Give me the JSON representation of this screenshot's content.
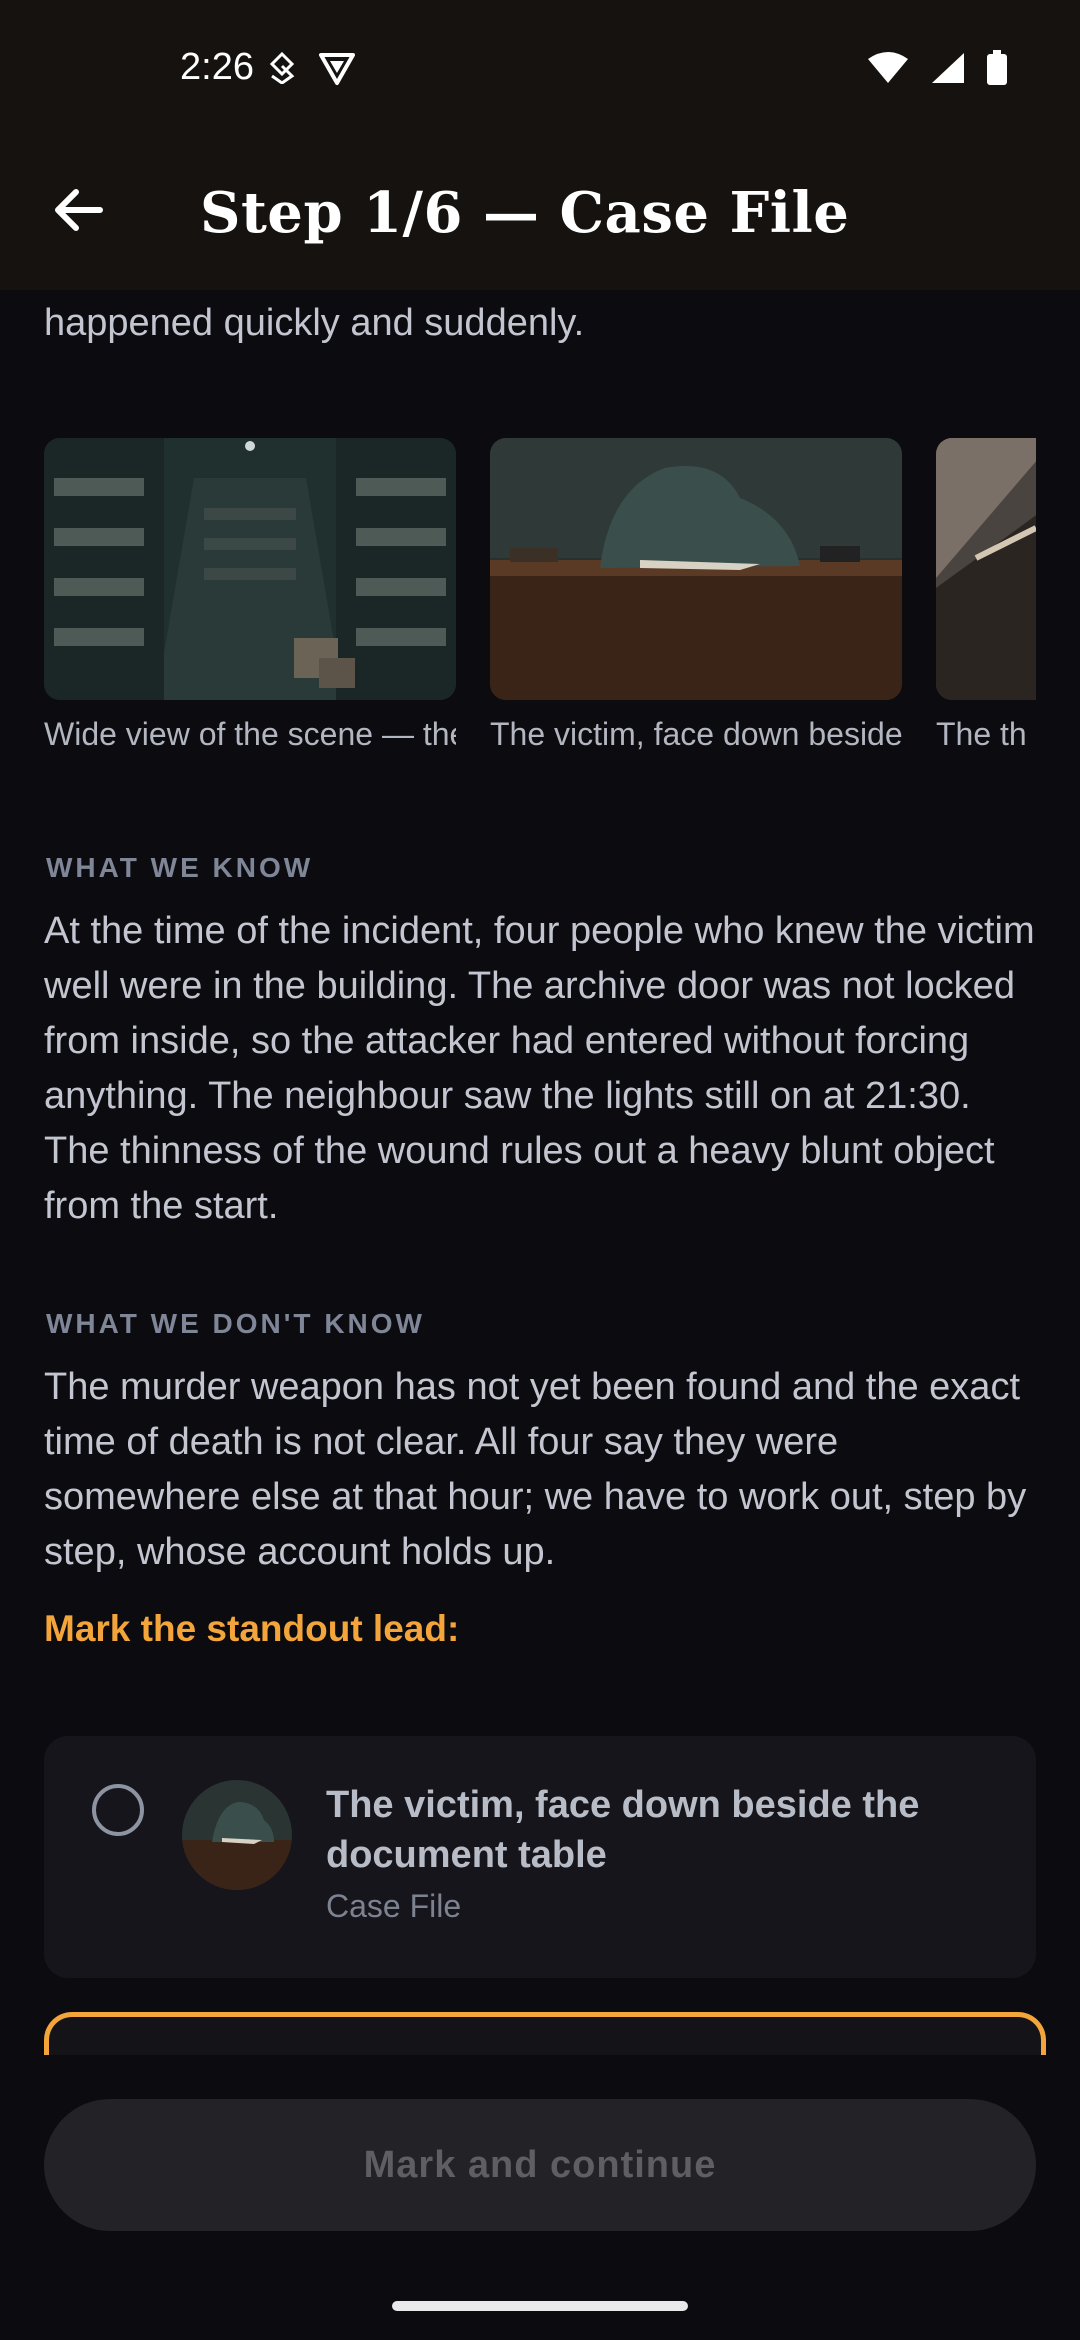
{
  "status_bar": {
    "time": "2:26",
    "left_icons": [
      "data-saver-icon",
      "vpn-shield-icon"
    ],
    "right_icons": [
      "wifi-icon",
      "signal-icon",
      "battery-icon"
    ]
  },
  "app_bar": {
    "back_icon": "arrow-left-icon",
    "title": "Step 1/6 — Case File"
  },
  "intro": {
    "text": "sign of a long struggle — everything seemed to have happened quickly and suddenly."
  },
  "gallery": {
    "items": [
      {
        "caption": "Wide view of the scene — the archive door is not l...",
        "image": "archive-room-image"
      },
      {
        "caption": "The victim, face down beside the document ta...",
        "image": "victim-at-desk-image"
      },
      {
        "caption": "The th neck –",
        "image": "closeup-image"
      }
    ]
  },
  "sections": {
    "know": {
      "label": "WHAT WE KNOW",
      "text": "At the time of the incident, four people who knew the victim well were in the building. The archive door was not locked from inside, so the attacker had entered without forcing anything. The neighbour saw the lights still on at 21:30. The thinness of the wound rules out a heavy blunt object from the start."
    },
    "dont_know": {
      "label": "WHAT WE DON'T KNOW",
      "text": "The murder weapon has not yet been found and the exact time of death is not clear. All four say they were somewhere else at that hour; we have to work out, step by step, whose account holds up."
    }
  },
  "prompt": "Mark the standout lead:",
  "option": {
    "title": "The victim, face down beside the document table",
    "subtitle": "Case File",
    "selected": false
  },
  "primary_button": {
    "label": "Mark and continue",
    "enabled": false
  },
  "colors": {
    "background": "#0c0b10",
    "app_bar": "#15120f",
    "accent": "#f3a43a",
    "card": "#16151b",
    "button_disabled_bg": "#232226"
  }
}
